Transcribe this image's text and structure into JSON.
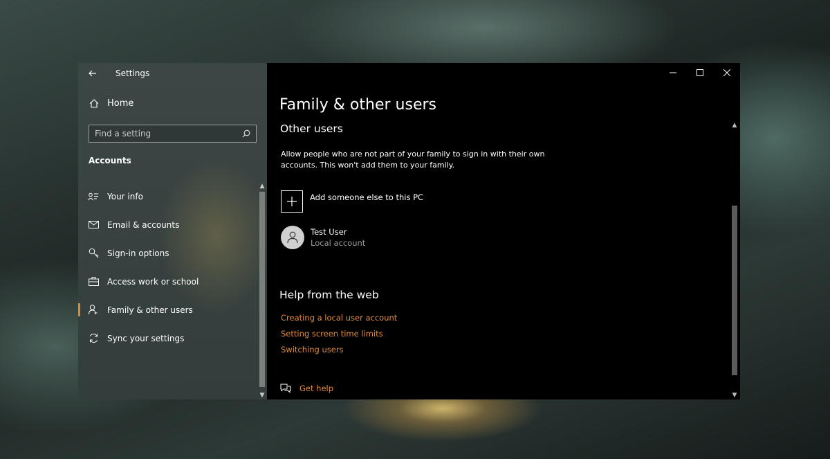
{
  "window": {
    "title": "Settings"
  },
  "sidebar": {
    "home_label": "Home",
    "search_placeholder": "Find a setting",
    "section_label": "Accounts",
    "items": [
      {
        "label": "Your info",
        "icon": "person-lines-icon"
      },
      {
        "label": "Email & accounts",
        "icon": "mail-icon"
      },
      {
        "label": "Sign-in options",
        "icon": "key-icon"
      },
      {
        "label": "Access work or school",
        "icon": "briefcase-icon"
      },
      {
        "label": "Family & other users",
        "icon": "person-add-icon",
        "active": true
      },
      {
        "label": "Sync your settings",
        "icon": "sync-icon"
      }
    ]
  },
  "main": {
    "page_title": "Family & other users",
    "section_title": "Other users",
    "description": "Allow people who are not part of your family to sign in with their own accounts. This won't add them to your family.",
    "add_label": "Add someone else to this PC",
    "user": {
      "name": "Test User",
      "type": "Local account"
    },
    "help_title": "Help from the web",
    "help_links": [
      "Creating a local user account",
      "Setting screen time limits",
      "Switching users"
    ],
    "get_help": "Get help"
  },
  "colors": {
    "accent": "#e38b3c",
    "active_indicator": "#e08a2e"
  }
}
